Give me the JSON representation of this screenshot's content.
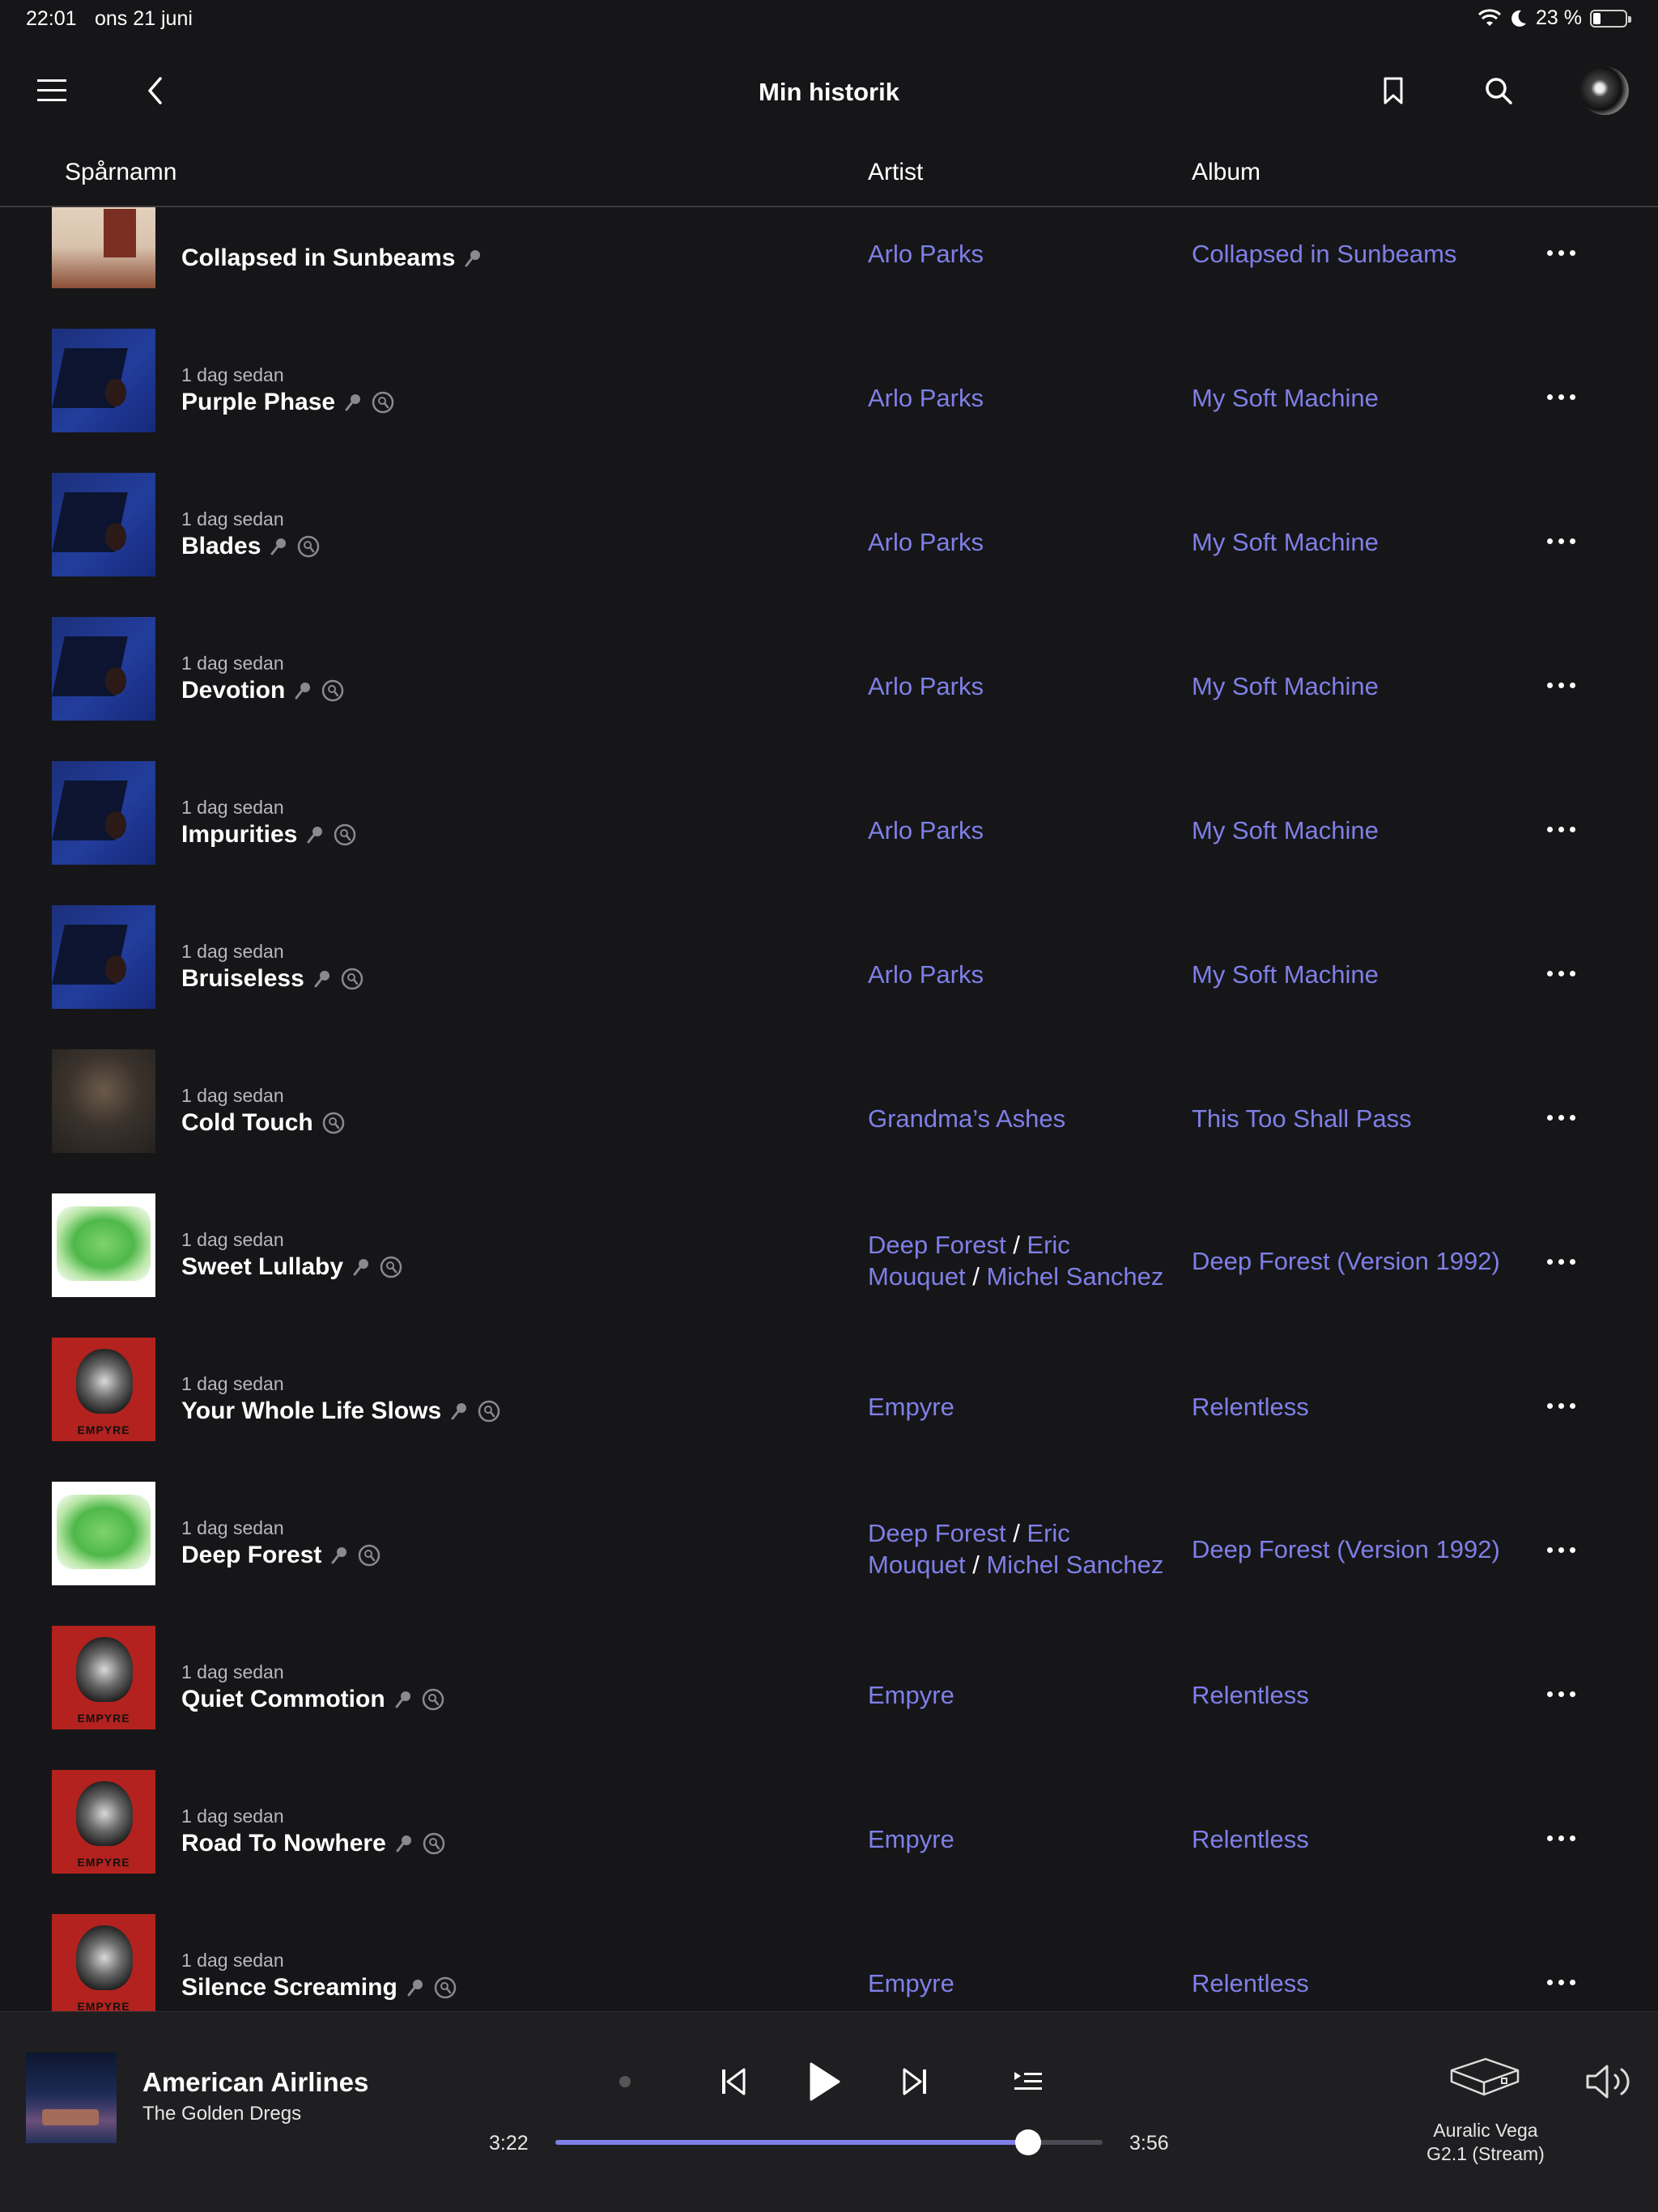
{
  "status_bar": {
    "time": "22:01",
    "date": "ons 21 juni",
    "battery": "23 %",
    "battery_level": 0.23
  },
  "nav": {
    "title": "Min historik"
  },
  "columns": {
    "track": "Spårnamn",
    "artist": "Artist",
    "album": "Album"
  },
  "rows": [
    {
      "thumb": "peach",
      "meta": "",
      "title": "Collapsed in Sunbeams",
      "mic": true,
      "tag": false,
      "artist": [
        "Arlo Parks"
      ],
      "artist2": [],
      "album": "Collapsed in Sunbeams"
    },
    {
      "thumb": "blue",
      "meta": "1 dag sedan",
      "title": "Purple Phase",
      "mic": true,
      "tag": true,
      "artist": [
        "Arlo Parks"
      ],
      "artist2": [],
      "album": "My Soft Machine"
    },
    {
      "thumb": "blue",
      "meta": "1 dag sedan",
      "title": "Blades",
      "mic": true,
      "tag": true,
      "artist": [
        "Arlo Parks"
      ],
      "artist2": [],
      "album": "My Soft Machine"
    },
    {
      "thumb": "blue",
      "meta": "1 dag sedan",
      "title": "Devotion",
      "mic": true,
      "tag": true,
      "artist": [
        "Arlo Parks"
      ],
      "artist2": [],
      "album": "My Soft Machine"
    },
    {
      "thumb": "blue",
      "meta": "1 dag sedan",
      "title": "Impurities",
      "mic": true,
      "tag": true,
      "artist": [
        "Arlo Parks"
      ],
      "artist2": [],
      "album": "My Soft Machine"
    },
    {
      "thumb": "blue",
      "meta": "1 dag sedan",
      "title": "Bruiseless",
      "mic": true,
      "tag": true,
      "artist": [
        "Arlo Parks"
      ],
      "artist2": [],
      "album": "My Soft Machine"
    },
    {
      "thumb": "dark",
      "meta": "1 dag sedan",
      "title": "Cold Touch",
      "mic": false,
      "tag": true,
      "artist": [
        "Grandma’s Ashes"
      ],
      "artist2": [],
      "album": "This Too Shall Pass"
    },
    {
      "thumb": "green",
      "meta": "1 dag sedan",
      "title": "Sweet Lullaby",
      "mic": true,
      "tag": true,
      "artist": [
        "Deep Forest",
        "Eric"
      ],
      "artist2": [
        "Mouquet",
        "Michel Sanchez"
      ],
      "album": "Deep Forest (Version 1992)"
    },
    {
      "thumb": "red",
      "meta": "1 dag sedan",
      "title": "Your Whole Life Slows",
      "mic": true,
      "tag": true,
      "artist": [
        "Empyre"
      ],
      "artist2": [],
      "album": "Relentless"
    },
    {
      "thumb": "green",
      "meta": "1 dag sedan",
      "title": "Deep Forest",
      "mic": true,
      "tag": true,
      "artist": [
        "Deep Forest",
        "Eric"
      ],
      "artist2": [
        "Mouquet",
        "Michel Sanchez"
      ],
      "album": "Deep Forest (Version 1992)"
    },
    {
      "thumb": "red",
      "meta": "1 dag sedan",
      "title": "Quiet Commotion",
      "mic": true,
      "tag": true,
      "artist": [
        "Empyre"
      ],
      "artist2": [],
      "album": "Relentless"
    },
    {
      "thumb": "red",
      "meta": "1 dag sedan",
      "title": "Road To Nowhere",
      "mic": true,
      "tag": true,
      "artist": [
        "Empyre"
      ],
      "artist2": [],
      "album": "Relentless"
    },
    {
      "thumb": "red",
      "meta": "1 dag sedan",
      "title": "Silence Screaming",
      "mic": true,
      "tag": true,
      "artist": [
        "Empyre"
      ],
      "artist2": [],
      "album": "Relentless"
    }
  ],
  "thumb_labels": {
    "red": "EMPYRE"
  },
  "player": {
    "title": "American Airlines",
    "artist": "The Golden Dregs",
    "elapsed": "3:22",
    "duration": "3:56",
    "progress": 0.864,
    "device_line1": "Auralic Vega",
    "device_line2": "G2.1 (Stream)"
  },
  "colors": {
    "accent": "#7f7fe8",
    "background": "#161618",
    "player_bg": "#1f1f22"
  },
  "icons": [
    "menu-icon",
    "back-icon",
    "bookmark-icon",
    "search-icon",
    "mic-icon",
    "tag-icon",
    "more-icon",
    "previous-icon",
    "play-icon",
    "next-icon",
    "queue-icon",
    "device-icon",
    "volume-icon"
  ]
}
